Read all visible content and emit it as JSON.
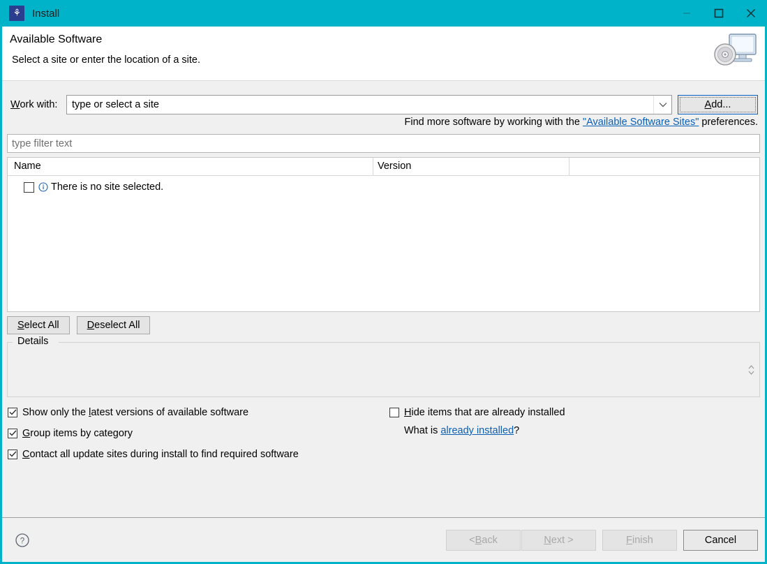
{
  "window": {
    "title": "Install",
    "app_icon": "eclipse-install-icon",
    "titlebar_color": "#00b3c8",
    "controls": {
      "minimize": "minimize-button",
      "maximize": "maximize-button",
      "close": "close-button"
    }
  },
  "banner": {
    "title": "Available Software",
    "subtitle": "Select a site or enter the location of a site.",
    "icon": "monitor-with-disc-icon"
  },
  "work_with": {
    "label_pre": "W",
    "label_post": "ork with:",
    "value": "type or select a site",
    "dropdown_icon": "chevron-down-icon",
    "add_button": {
      "pre": "A",
      "post": "dd...",
      "focused": true,
      "focus_color": "#0a64c8"
    }
  },
  "find_more": {
    "prefix": "Find more software by working with the ",
    "link": "\"Available Software Sites\"",
    "suffix": " preferences.",
    "link_color": "#0b5fb3"
  },
  "filter": {
    "placeholder": "type filter text",
    "value": ""
  },
  "table": {
    "columns": [
      "Name",
      "Version",
      ""
    ],
    "rows": [
      {
        "checked": false,
        "icon": "info-icon",
        "name": "There is no site selected.",
        "version": ""
      }
    ]
  },
  "list_buttons": {
    "select_all": {
      "pre": "S",
      "post": "elect All"
    },
    "deselect_all": {
      "pre": "D",
      "post": "eselect All"
    }
  },
  "details": {
    "legend": "Details",
    "body": "",
    "spinner_icon": "up-down-spinner-icon"
  },
  "options": {
    "left": [
      {
        "pre": "Show only the ",
        "mn": "l",
        "post": "atest versions of available software",
        "checked": true
      },
      {
        "pre": "",
        "mn": "G",
        "post": "roup items by category",
        "checked": true
      },
      {
        "pre": "",
        "mn": "C",
        "post": "ontact all update sites during install to find required software",
        "checked": true
      }
    ],
    "right": [
      {
        "pre": "",
        "mn": "H",
        "post": "ide items that are already installed",
        "checked": false
      }
    ],
    "what_is": {
      "prefix": "What is ",
      "link": "already installed",
      "suffix": "?"
    }
  },
  "footer": {
    "help_icon": "help-question-icon",
    "buttons": [
      {
        "pre": "< ",
        "mn": "B",
        "post": "ack",
        "enabled": false
      },
      {
        "pre": "",
        "mn": "N",
        "post": "ext >",
        "enabled": false
      },
      {
        "pre": "",
        "mn": "F",
        "post": "inish",
        "enabled": false
      },
      {
        "pre": "",
        "mn": "",
        "post": "Cancel",
        "enabled": true
      }
    ]
  }
}
